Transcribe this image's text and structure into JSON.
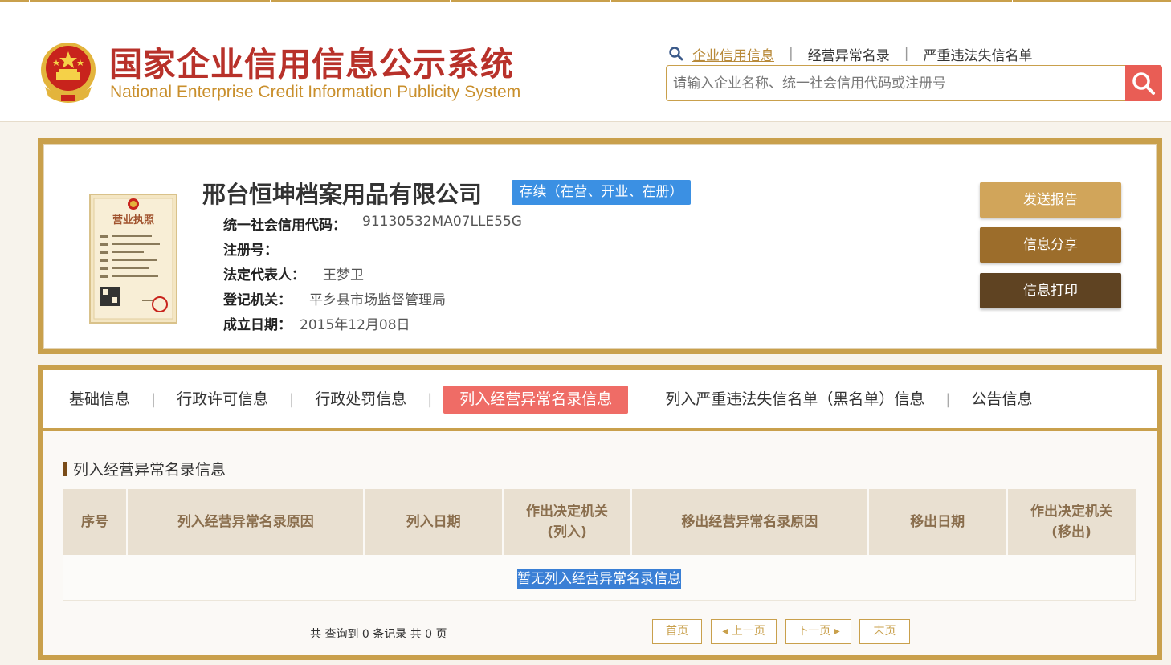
{
  "header": {
    "title": "国家企业信用信息公示系统",
    "subtitle": "National Enterprise Credit Information Publicity System",
    "nav": [
      {
        "label": "企业信用信息"
      },
      {
        "label": "经营异常名录"
      },
      {
        "label": "严重违法失信名单"
      }
    ],
    "separator": "|",
    "search_placeholder": "请输入企业名称、统一社会信用代码或注册号"
  },
  "company": {
    "name": "邢台恒坤档案用品有限公司",
    "status": "存续（在营、开业、在册）",
    "credit_code_label": "统一社会信用代码：",
    "credit_code": "91130532MA07LLE55G",
    "reg_no_label": "注册号：",
    "reg_no": "",
    "legal_rep_label": "法定代表人：",
    "legal_rep": "王梦卫",
    "authority_label": "登记机关：",
    "authority": "平乡县市场监督管理局",
    "founded_label": "成立日期：",
    "founded": "2015年12月08日",
    "license_title": "营业执照",
    "actions": {
      "send_report": "发送报告",
      "share": "信息分享",
      "print": "信息打印"
    }
  },
  "tabs": [
    {
      "label": "基础信息"
    },
    {
      "label": "行政许可信息"
    },
    {
      "label": "行政处罚信息"
    },
    {
      "label": "列入经营异常名录信息"
    },
    {
      "label": "列入严重违法失信名单（黑名单）信息"
    },
    {
      "label": "公告信息"
    }
  ],
  "section": {
    "title": "列入经营异常名录信息",
    "columns": [
      "序号",
      "列入经营异常名录原因",
      "列入日期",
      "作出决定机关\n(列入)",
      "移出经营异常名录原因",
      "移出日期",
      "作出决定机关\n(移出)"
    ],
    "empty_text": "暂无列入经营异常名录信息",
    "summary": "共 查询到 0 条记录 共 0 页"
  },
  "pager": {
    "first": "首页",
    "prev": "◂ 上一页",
    "next": "下一页 ▸",
    "last": "末页"
  },
  "colors": {
    "gold": "#c9a04c",
    "active_tab": "#ef6c66",
    "status": "#3b90e3",
    "search_btn": "#e95d55"
  }
}
